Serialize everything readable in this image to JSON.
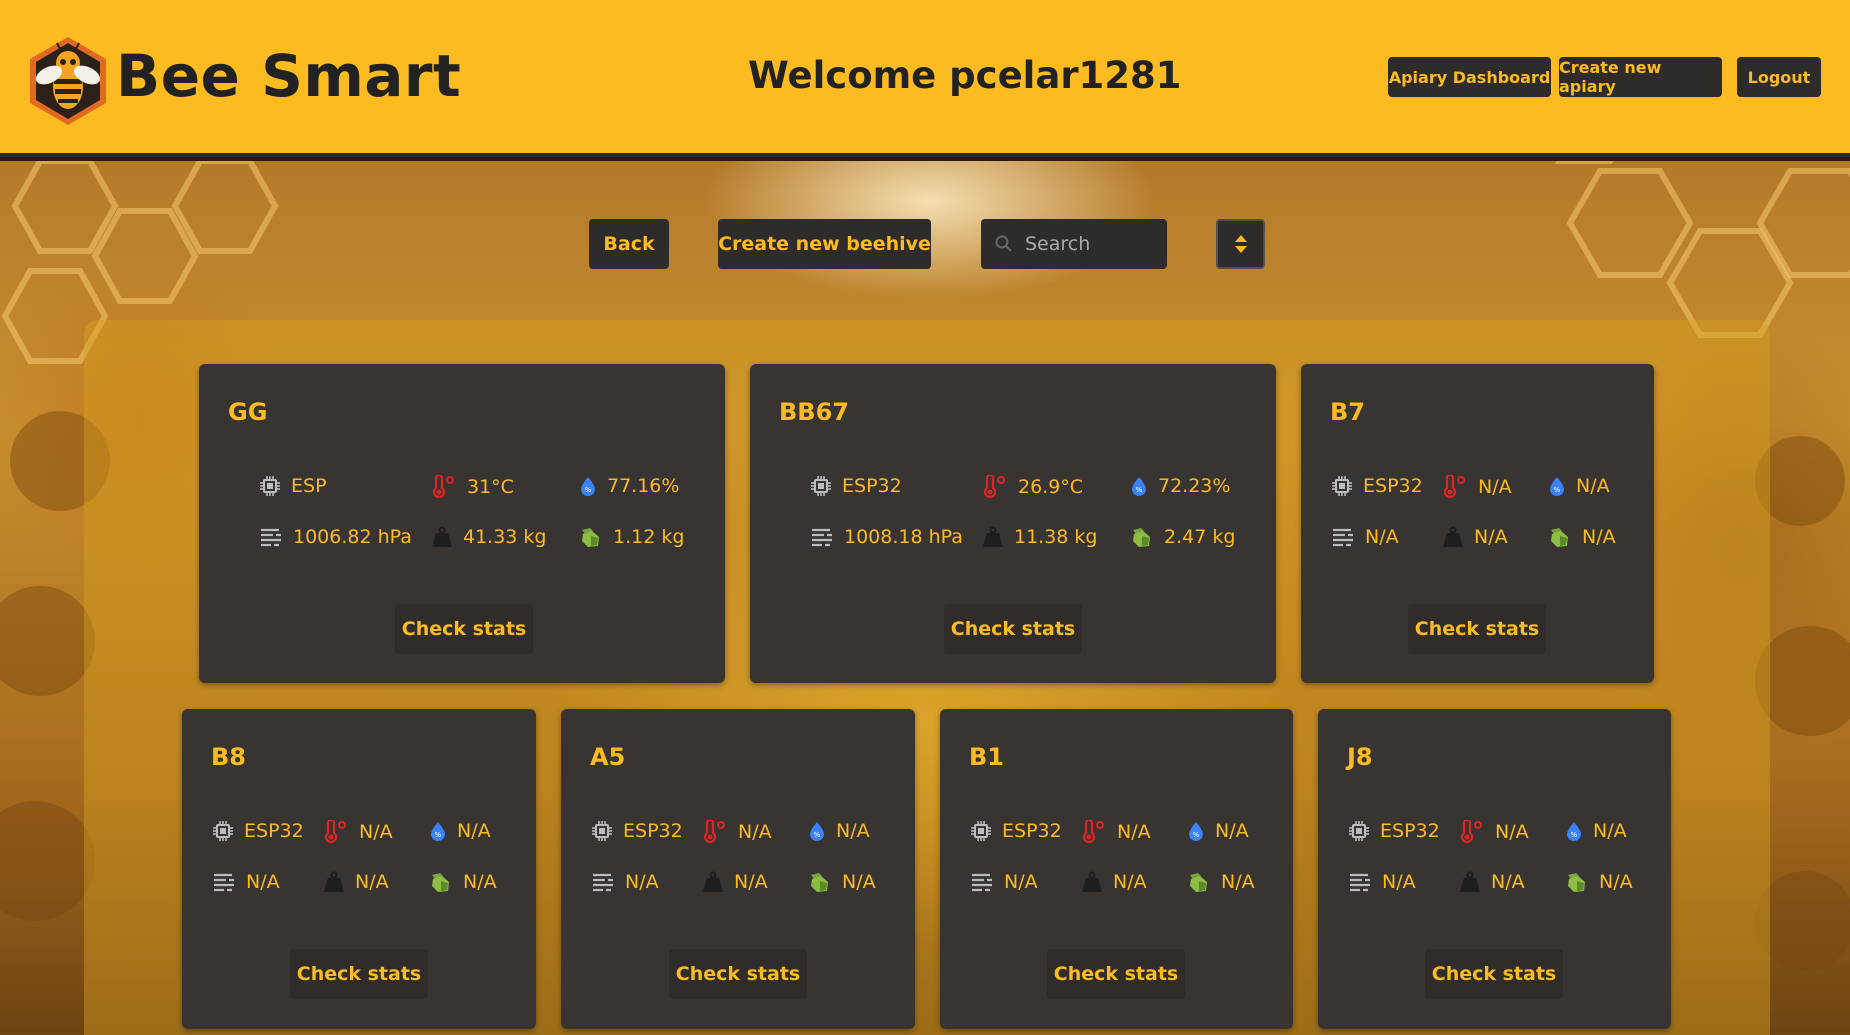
{
  "header": {
    "brand": "Bee Smart",
    "welcome": "Welcome pcelar1281",
    "nav": {
      "apiary_dashboard": "Apiary Dashboard",
      "create_apiary": "Create new apiary",
      "logout": "Logout"
    }
  },
  "toolbar": {
    "back": "Back",
    "create_beehive": "Create new beehive",
    "search_placeholder": "Search"
  },
  "hives": [
    {
      "name": "GG",
      "device": "ESP",
      "temperature": "31°C",
      "humidity": "77.16%",
      "pressure": "1006.82 hPa",
      "weight": "41.33 kg",
      "honey": "1.12 kg",
      "button": "Check stats"
    },
    {
      "name": "BB67",
      "device": "ESP32",
      "temperature": "26.9°C",
      "humidity": "72.23%",
      "pressure": "1008.18 hPa",
      "weight": "11.38 kg",
      "honey": "2.47 kg",
      "button": "Check stats"
    },
    {
      "name": "B7",
      "device": "ESP32",
      "temperature": "N/A",
      "humidity": "N/A",
      "pressure": "N/A",
      "weight": "N/A",
      "honey": "N/A",
      "button": "Check stats"
    },
    {
      "name": "B8",
      "device": "ESP32",
      "temperature": "N/A",
      "humidity": "N/A",
      "pressure": "N/A",
      "weight": "N/A",
      "honey": "N/A",
      "button": "Check stats"
    },
    {
      "name": "A5",
      "device": "ESP32",
      "temperature": "N/A",
      "humidity": "N/A",
      "pressure": "N/A",
      "weight": "N/A",
      "honey": "N/A",
      "button": "Check stats"
    },
    {
      "name": "B1",
      "device": "ESP32",
      "temperature": "N/A",
      "humidity": "N/A",
      "pressure": "N/A",
      "weight": "N/A",
      "honey": "N/A",
      "button": "Check stats"
    },
    {
      "name": "J8",
      "device": "ESP32",
      "temperature": "N/A",
      "humidity": "N/A",
      "pressure": "N/A",
      "weight": "N/A",
      "honey": "N/A",
      "button": "Check stats"
    }
  ],
  "colors": {
    "accent": "#fdbb22",
    "card": "#383432",
    "button": "#2e2c2b",
    "temperature_icon": "#e02424",
    "humidity_icon": "#3b82f6",
    "honey_icon": "#7aa33a",
    "neutral_icon": "#bdbdbd"
  },
  "icons": {
    "device": "chip-icon",
    "temperature": "thermometer-icon",
    "humidity": "water-drop-icon",
    "pressure": "pressure-lines-icon",
    "weight": "weight-icon",
    "honey": "honey-jar-icon",
    "search": "search-icon",
    "sort": "sort-icon"
  }
}
